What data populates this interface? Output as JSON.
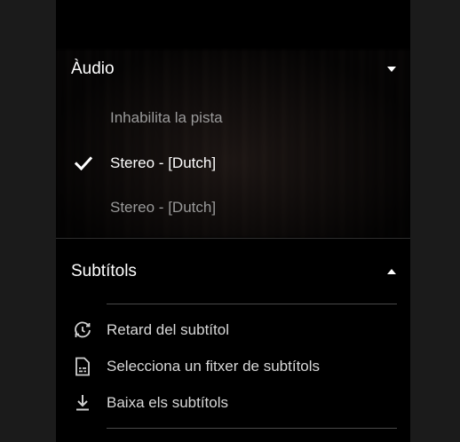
{
  "audio": {
    "title": "Àudio",
    "tracks": [
      {
        "label": "Inhabilita la pista",
        "selected": false
      },
      {
        "label": "Stereo - [Dutch]",
        "selected": true
      },
      {
        "label": "Stereo - [Dutch]",
        "selected": false
      }
    ]
  },
  "subtitles": {
    "title": "Subtítols",
    "items": [
      {
        "label": "Retard del subtítol",
        "icon": "subtitle-delay-icon"
      },
      {
        "label": "Selecciona un fitxer de subtítols",
        "icon": "subtitle-file-icon"
      },
      {
        "label": "Baixa els subtítols",
        "icon": "download-icon"
      }
    ]
  }
}
